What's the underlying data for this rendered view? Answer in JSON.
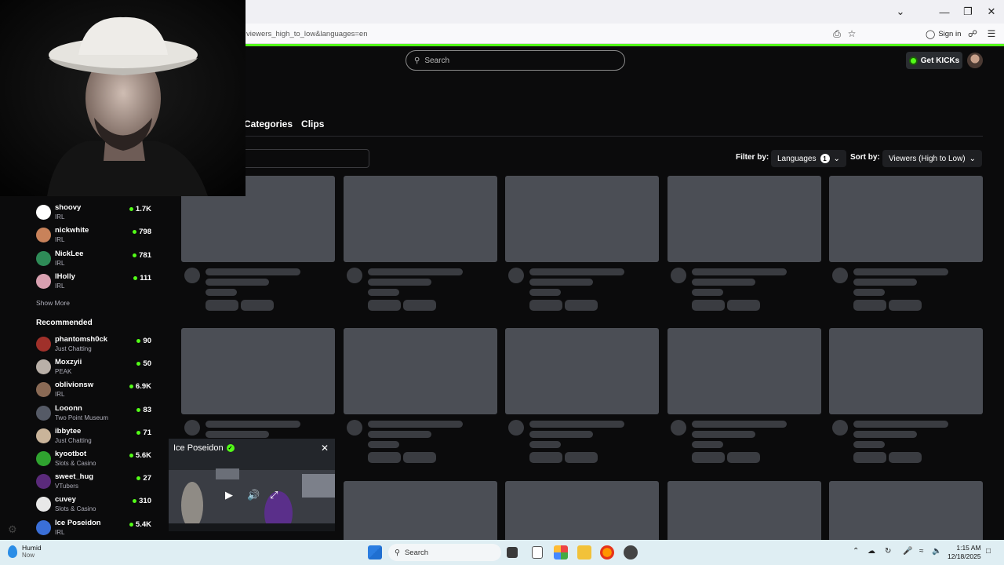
{
  "browser": {
    "url": "viewers_high_to_low&languages=en",
    "sign_in": "Sign in"
  },
  "header": {
    "search_placeholder": "Search",
    "get_kicks": "Get KICKs"
  },
  "nav": {
    "tabs": [
      "Categories",
      "Clips"
    ]
  },
  "filters": {
    "filter_by_label": "Filter by:",
    "languages_label": "Languages",
    "languages_count": "1",
    "sort_by_label": "Sort by:",
    "sort_value": "Viewers (High to Low)"
  },
  "sidebar": {
    "following": [
      {
        "name": "shoovy",
        "category": "IRL",
        "viewers": "1.7K",
        "avatar_color": "#ffffff"
      },
      {
        "name": "nickwhite",
        "category": "IRL",
        "viewers": "798",
        "avatar_color": "#c8825a"
      },
      {
        "name": "NickLee",
        "category": "IRL",
        "viewers": "781",
        "avatar_color": "#2e8b57"
      },
      {
        "name": "lHolly",
        "category": "IRL",
        "viewers": "111",
        "avatar_color": "#d8a0b0"
      }
    ],
    "show_more": "Show More",
    "recommended_title": "Recommended",
    "recommended": [
      {
        "name": "phantomsh0ck",
        "category": "Just Chatting",
        "viewers": "90",
        "avatar_color": "#a0302a"
      },
      {
        "name": "Moxzyii",
        "category": "PEAK",
        "viewers": "50",
        "avatar_color": "#b9b0a8"
      },
      {
        "name": "oblivionsw",
        "category": "IRL",
        "viewers": "6.9K",
        "avatar_color": "#8a6a55"
      },
      {
        "name": "Looonn",
        "category": "Two Point Museum",
        "viewers": "83",
        "avatar_color": "#555a66"
      },
      {
        "name": "ibbytee",
        "category": "Just Chatting",
        "viewers": "71",
        "avatar_color": "#c9b49a"
      },
      {
        "name": "kyootbot",
        "category": "Slots & Casino",
        "viewers": "5.6K",
        "avatar_color": "#2fa32f"
      },
      {
        "name": "sweet_hug",
        "category": "VTubers",
        "viewers": "27",
        "avatar_color": "#5a2a7a"
      },
      {
        "name": "cuvey",
        "category": "Slots & Casino",
        "viewers": "310",
        "avatar_color": "#e8e8e8"
      },
      {
        "name": "Ice Poseidon",
        "category": "IRL",
        "viewers": "5.4K",
        "avatar_color": "#3a6fd8"
      }
    ]
  },
  "mini_player": {
    "title": "Ice Poseidon"
  },
  "taskbar": {
    "weather_title": "Humid",
    "weather_sub": "Now",
    "search_label": "Search",
    "time": "1:15 AM",
    "date": "12/18/2025"
  },
  "colors": {
    "accent": "#53fc18",
    "skeleton": "#4b4e55"
  }
}
